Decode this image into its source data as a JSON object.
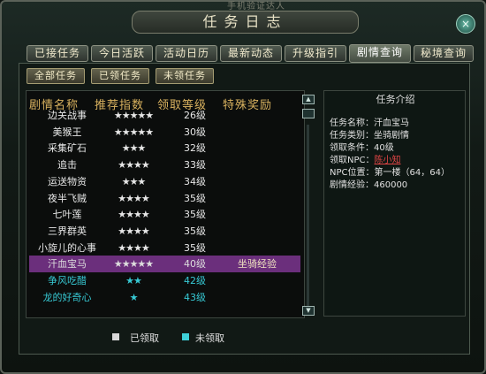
{
  "window": {
    "top_clipped_text": "手机验证达人",
    "title": "任务日志",
    "close_glyph": "×"
  },
  "tabs": [
    {
      "label": "已接任务"
    },
    {
      "label": "今日活跃"
    },
    {
      "label": "活动日历"
    },
    {
      "label": "最新动态"
    },
    {
      "label": "升级指引"
    },
    {
      "label": "剧情查询",
      "active": true
    },
    {
      "label": "秘境查询"
    }
  ],
  "filters": [
    {
      "label": "全部任务"
    },
    {
      "label": "已领任务"
    },
    {
      "label": "未领任务"
    }
  ],
  "columns": {
    "name": "剧情名称",
    "stars": "推荐指数",
    "level": "领取等级",
    "reward": "特殊奖励"
  },
  "rows": [
    {
      "name": "边关战事",
      "stars": "★★★★★",
      "level": "26级",
      "reward": "",
      "state": "received"
    },
    {
      "name": "美猴王",
      "stars": "★★★★★",
      "level": "30级",
      "reward": "",
      "state": "received"
    },
    {
      "name": "采集矿石",
      "stars": "★★★",
      "level": "32级",
      "reward": "",
      "state": "received"
    },
    {
      "name": "追击",
      "stars": "★★★★",
      "level": "33级",
      "reward": "",
      "state": "received"
    },
    {
      "name": "运送物资",
      "stars": "★★★",
      "level": "34级",
      "reward": "",
      "state": "received"
    },
    {
      "name": "夜半飞贼",
      "stars": "★★★★",
      "level": "35级",
      "reward": "",
      "state": "received"
    },
    {
      "name": "七叶莲",
      "stars": "★★★★",
      "level": "35级",
      "reward": "",
      "state": "received"
    },
    {
      "name": "三界群英",
      "stars": "★★★★",
      "level": "35级",
      "reward": "",
      "state": "received"
    },
    {
      "name": "小旋儿的心事",
      "stars": "★★★★",
      "level": "35级",
      "reward": "",
      "state": "received"
    },
    {
      "name": "汗血宝马",
      "stars": "★★★★★",
      "level": "40级",
      "reward": "坐骑经验",
      "state": "selected"
    },
    {
      "name": "争风吃醋",
      "stars": "★★",
      "level": "42级",
      "reward": "",
      "state": "unreceived"
    },
    {
      "name": "龙的好奇心",
      "stars": "★",
      "level": "43级",
      "reward": "",
      "state": "unreceived"
    }
  ],
  "scrollbar": {
    "up": "▲",
    "down": "▼"
  },
  "detail": {
    "title": "任务介绍",
    "name_label": "任务名称：",
    "name": "汗血宝马",
    "category_label": "任务类别：",
    "category": "坐骑剧情",
    "condition_label": "领取条件：",
    "condition": "40级",
    "npc_label": "领取NPC：",
    "npc": "陈小知",
    "npc_pos_label": "NPC位置：",
    "npc_pos": "第一楼（64，64）",
    "exp_label": "剧情经验：",
    "exp": "460000"
  },
  "legend": {
    "received": "已领取",
    "unreceived": "未领取",
    "received_color": "#d8d8d8",
    "unreceived_color": "#3ed0d8"
  },
  "colors": {
    "header_gold": "#d9b25f",
    "selected_row": "#6b2f7c",
    "unreceived_text": "#37c9d4",
    "npc_link": "#e44646"
  }
}
